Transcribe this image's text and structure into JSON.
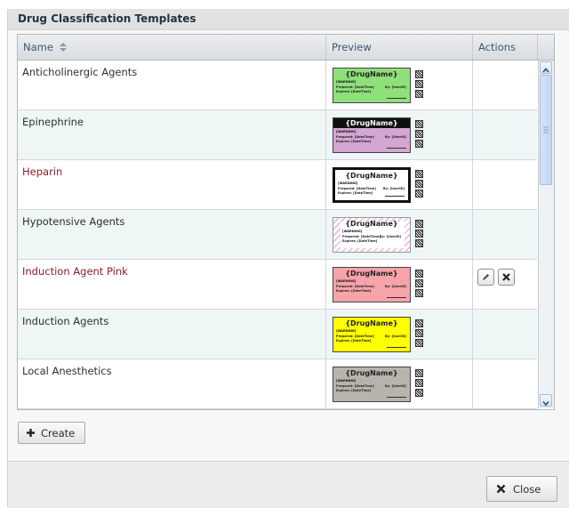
{
  "dialog": {
    "title": "Drug Classification Templates"
  },
  "grid": {
    "columns": {
      "name": "Name",
      "preview": "Preview",
      "actions": "Actions"
    },
    "rows": [
      {
        "name": "Anticholinergic Agents",
        "label_bg": "#8fe07a",
        "label_head": "#8fe07a",
        "head_text": "#222222",
        "border": "#333333",
        "stripes": false
      },
      {
        "name": "Epinephrine",
        "label_bg": "#d4a6d2",
        "label_head": "#111111",
        "head_text": "#ffffff",
        "border": "#333333",
        "stripes": false
      },
      {
        "name": "Heparin",
        "label_bg": "#ffffff",
        "label_head": "#ffffff",
        "head_text": "#111111",
        "border": "#111111",
        "stripes": false,
        "thick": true
      },
      {
        "name": "Hypotensive Agents",
        "label_bg": "#ffffff",
        "label_head": "#ffffff",
        "head_text": "#111111",
        "border": "#888888",
        "stripes": true
      },
      {
        "name": "Induction Agent Pink",
        "label_bg": "#f7a3ac",
        "label_head": "#f7a3ac",
        "head_text": "#111111",
        "border": "#333333",
        "stripes": false,
        "actions": true
      },
      {
        "name": "Induction Agents",
        "label_bg": "#ffff00",
        "label_head": "#ffff00",
        "head_text": "#111111",
        "border": "#333333",
        "stripes": false
      },
      {
        "name": "Local Anesthetics",
        "label_bg": "#b6b4ad",
        "label_head": "#b6b4ad",
        "head_text": "#111111",
        "border": "#333333",
        "stripes": false
      }
    ],
    "label_text": {
      "drug_name": "{DrugName}",
      "warning": "[WARNING]",
      "line1": "Prepared: [DateTime]",
      "line2": "Expires: [DateTime]",
      "right1": "By: [UserID]"
    }
  },
  "buttons": {
    "create": "Create",
    "close": "Close"
  },
  "colors": {
    "title": "#1f3146",
    "header_text": "#3c5673",
    "name_red": "#8a1d2c",
    "row_alt": "#eef6f6"
  }
}
